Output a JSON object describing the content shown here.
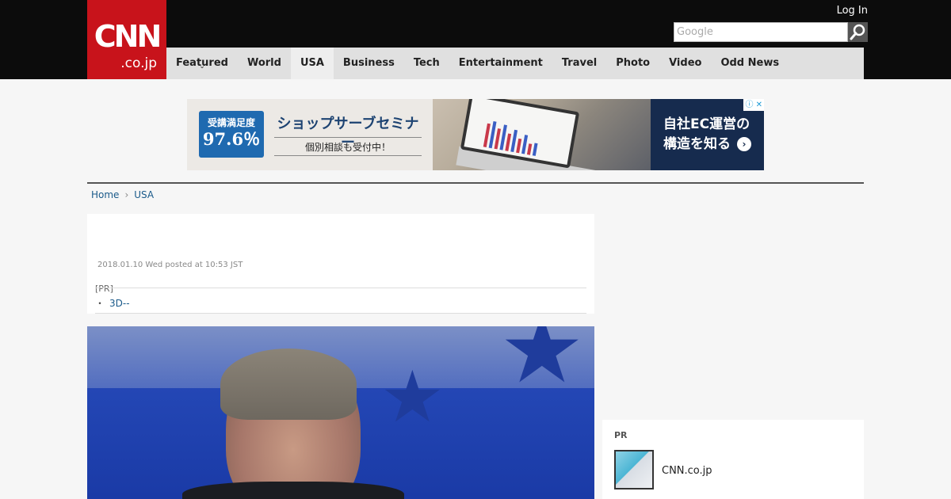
{
  "header": {
    "logo_main": "CNN",
    "logo_sub": ".co.jp",
    "login_label": "Log In",
    "search_placeholder": "Google"
  },
  "nav": {
    "items": [
      {
        "label": "Featured"
      },
      {
        "label": "World"
      },
      {
        "label": "USA"
      },
      {
        "label": "Business"
      },
      {
        "label": "Tech"
      },
      {
        "label": "Entertainment"
      },
      {
        "label": "Travel"
      },
      {
        "label": "Photo"
      },
      {
        "label": "Video"
      },
      {
        "label": "Odd News"
      }
    ],
    "active": "USA"
  },
  "ad": {
    "badge_line1": "受講満足度",
    "badge_line2": "97.6％",
    "title": "ショップサーブセミナー",
    "subtitle": "個別相談も受付中！",
    "right_line1": "自社EC運営の",
    "right_line2": "構造を知る"
  },
  "breadcrumb": {
    "home": "Home",
    "current": "USA"
  },
  "article": {
    "posted": "2018.01.10 Wed posted at 10:53 JST",
    "pr_label": "[PR]",
    "pr_link": "3D--"
  },
  "sidebar": {
    "pr_label": "PR",
    "pr_item": "CNN.co.jp"
  },
  "colors": {
    "brand_red": "#c8131b",
    "link_blue": "#1a5a8a"
  }
}
